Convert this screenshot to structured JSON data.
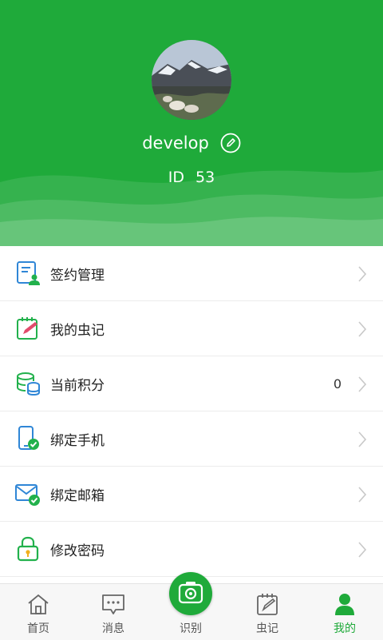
{
  "profile": {
    "username": "develop",
    "id_label": "ID",
    "id_value": "53"
  },
  "menu": [
    {
      "label": "签约管理",
      "icon": "contract-manage-icon",
      "value": ""
    },
    {
      "label": "我的虫记",
      "icon": "notebook-edit-icon",
      "value": ""
    },
    {
      "label": "当前积分",
      "icon": "coins-stack-icon",
      "value": "0"
    },
    {
      "label": "绑定手机",
      "icon": "phone-check-icon",
      "value": ""
    },
    {
      "label": "绑定邮箱",
      "icon": "mail-check-icon",
      "value": ""
    },
    {
      "label": "修改密码",
      "icon": "lock-icon",
      "value": ""
    }
  ],
  "tabs": [
    {
      "label": "首页",
      "icon": "home-icon"
    },
    {
      "label": "消息",
      "icon": "message-icon"
    },
    {
      "label": "识别",
      "icon": "camera-icon"
    },
    {
      "label": "虫记",
      "icon": "notebook-icon"
    },
    {
      "label": "我的",
      "icon": "person-icon",
      "active": true
    }
  ],
  "colors": {
    "brand_green": "#1faa3a",
    "icon_blue": "#2f86d6",
    "icon_green": "#22b14c"
  }
}
